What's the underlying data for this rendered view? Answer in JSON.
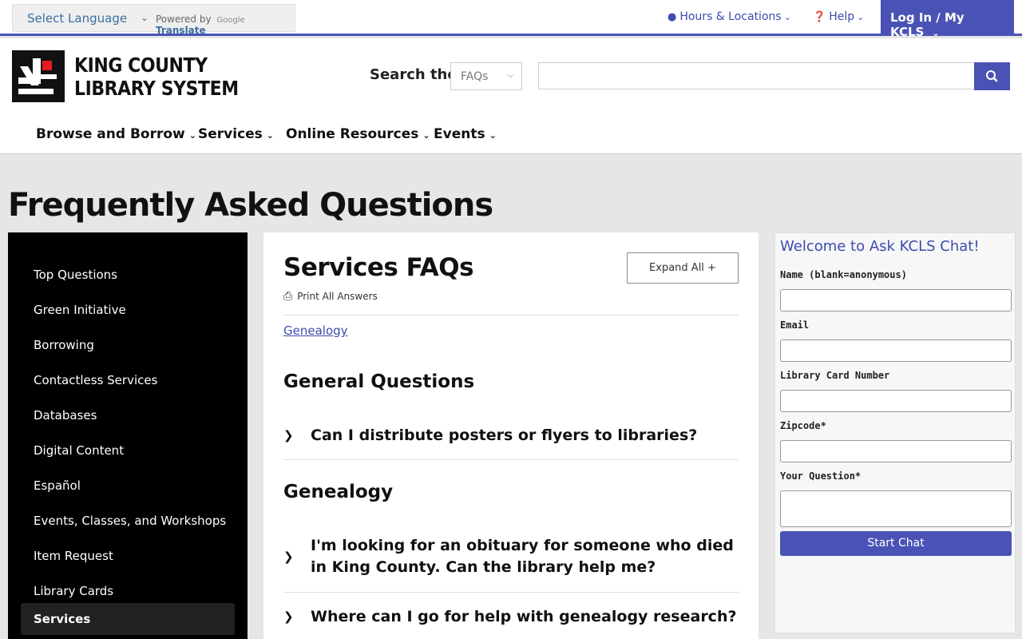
{
  "topbar": {
    "language_label": "Select Language",
    "powered_by": "Powered by",
    "google": "Google",
    "translate": "Translate",
    "hours_locations": "Hours & Locations",
    "help": "Help",
    "login": "Log In / My KCLS"
  },
  "header": {
    "logo_line1": "KING COUNTY",
    "logo_line2": "LIBRARY SYSTEM",
    "search_label": "Search the",
    "search_scope": "FAQs",
    "nav": [
      "Browse and Borrow",
      "Services",
      "Online Resources",
      "Events"
    ]
  },
  "page": {
    "title": "Frequently Asked Questions"
  },
  "sidebar": {
    "items": [
      "Top Questions",
      "Green Initiative",
      "Borrowing",
      "Contactless Services",
      "Databases",
      "Digital Content",
      "Español",
      "Events, Classes, and Workshops",
      "Item Request",
      "Library Cards",
      "Services"
    ],
    "active": "Services"
  },
  "content": {
    "heading": "Services FAQs",
    "expand_all": "Expand All +",
    "print_all": "Print All Answers",
    "jump_link": "Genealogy",
    "sections": [
      {
        "title": "General Questions",
        "questions": [
          "Can I distribute posters or flyers to libraries?"
        ]
      },
      {
        "title": "Genealogy",
        "questions": [
          "I'm looking for an obituary for someone who died in King County. Can the library help me?",
          "Where can I go for help with genealogy research?"
        ]
      }
    ]
  },
  "chat": {
    "title": "Welcome to Ask KCLS Chat!",
    "name_label": "Name (blank=anonymous)",
    "email_label": "Email",
    "card_label": "Library Card Number",
    "zip_label": "Zipcode*",
    "question_label": "Your Question*",
    "start_button": "Start Chat"
  },
  "colors": {
    "accent": "#4a53b5",
    "logo_red": "#e11b22"
  }
}
